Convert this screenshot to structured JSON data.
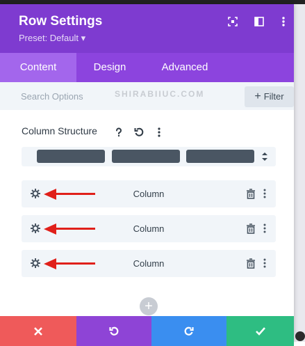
{
  "header": {
    "title": "Row Settings",
    "preset": "Preset: Default ▾",
    "icons": [
      "fullscreen-icon",
      "split-view-icon",
      "more-icon"
    ]
  },
  "tabs": [
    {
      "label": "Content",
      "active": true
    },
    {
      "label": "Design",
      "active": false
    },
    {
      "label": "Advanced",
      "active": false
    }
  ],
  "search": {
    "placeholder": "Search Options",
    "watermark": "SHIRABIIUC.COM",
    "filter_label": "Filter"
  },
  "column_structure": {
    "label": "Column Structure"
  },
  "columns": [
    {
      "label": "Column"
    },
    {
      "label": "Column"
    },
    {
      "label": "Column"
    }
  ],
  "footer": {
    "buttons": [
      "cancel",
      "undo",
      "redo",
      "save"
    ],
    "colors": [
      "#ef5a5a",
      "#8e44d6",
      "#3a8ef0",
      "#2ebd82"
    ]
  },
  "colors": {
    "header": "#7e3bd0",
    "tab_bar": "#8c44de",
    "tab_active": "#a366ec",
    "arrow": "#e0201a"
  }
}
